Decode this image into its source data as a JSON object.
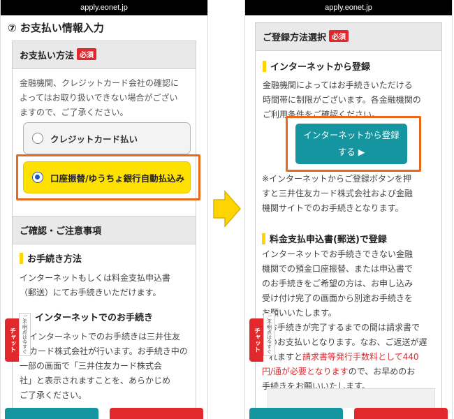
{
  "left": {
    "url": "apply.eonet.jp",
    "section_title": "⑦ お支払い情報入力",
    "payment_card": {
      "title": "お支払い方法",
      "required": "必須",
      "note_lines": [
        "金融機関、クレジットカード会社の確認に",
        "よってはお取り扱いできない場合がござい",
        "ますので、ご了承ください。"
      ]
    },
    "options": [
      {
        "label": "クレジットカード払い",
        "selected": false
      },
      {
        "label": "口座振替/ゆうちょ銀行自動払込み",
        "selected": true
      }
    ],
    "notes_card": {
      "title": "ご確認・ご注意事項",
      "procedure_heading": "お手続き方法",
      "procedure_lines": [
        "インターネットもしくは料金支払申込書",
        "（郵送）にてお手続きいただけます。"
      ],
      "internet_heading": "インターネットでのお手続き",
      "internet_lines": [
        "インターネットでのお手続きは三井住友",
        "カード株式会社が行います。お手続き中の",
        "一部の画面で「三井住友カード株式会",
        "社」と表示されますことを、あらかじめ",
        "ご了承ください。"
      ]
    },
    "chat_tab": "チャット",
    "question_tab": "ご不明点は今すぐ"
  },
  "right": {
    "url": "apply.eonet.jp",
    "card_title": "ご登録方法選択",
    "required": "必須",
    "internet_heading": "インターネットから登録",
    "internet_lines": [
      "金融機関によってはお手続きいただける",
      "時間帯に制限がございます。各金融機関の",
      "ご利用条件をご確認ください。"
    ],
    "internet_button_line1": "インターネットから登録",
    "internet_button_line2": "する",
    "note_lines": [
      "※インターネットからご登録ボタンを押",
      "すと三井住友カード株式会社および金融",
      "機関サイトでのお手続きとなります。"
    ],
    "mail_heading": "料金支払申込書(郵送)で登録",
    "mail_lines": [
      "インターネットでお手続きできない金融",
      "機関での預金口座振替、または申込書で",
      "のお手続きをご希望の方は、お申し込み",
      "受け付け完了の画面から別途お手続きを",
      "お願いいたします。",
      "お手続きが完了するまでの間は請求書で",
      "のお支払いとなります。なお、ご返送が遅"
    ],
    "mail_line_pre": "れますと",
    "mail_red": "請求書等発行手数料として440",
    "mail_red2": "円/通が必要となります",
    "mail_line_post": "ので、お早めのお",
    "mail_last": "手続きをお願いいたします。",
    "chat_tab": "チャット",
    "question_tab": "ご不明点は今すぐ"
  },
  "colors": {
    "selected_yellow": "#ffe100",
    "highlight_orange": "#e66a1a",
    "teal": "#14959f",
    "required_red": "#e0282d"
  }
}
